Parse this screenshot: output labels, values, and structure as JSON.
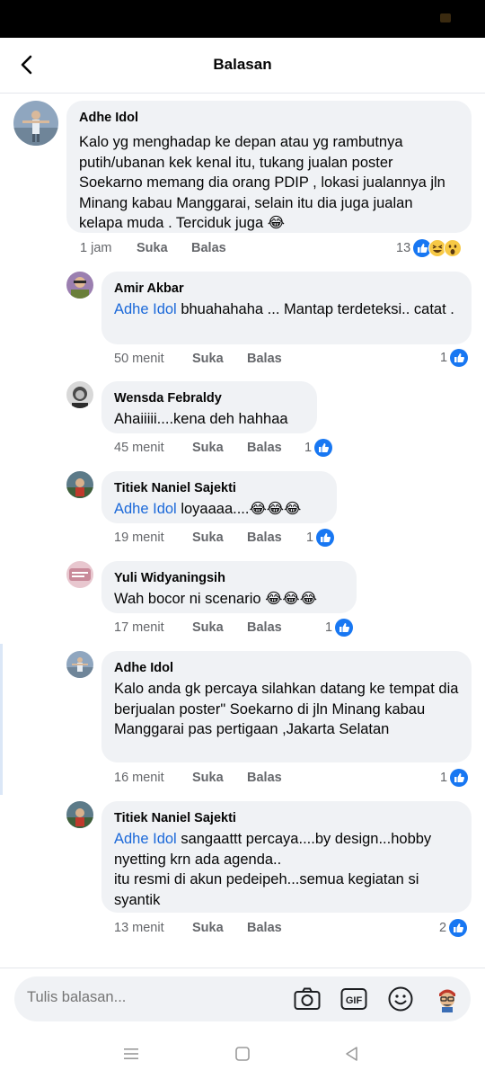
{
  "header": {
    "title": "Balasan"
  },
  "icons": {
    "back": "arrow-left-icon",
    "camera": "camera-icon",
    "gif": "gif-icon",
    "emoji": "smiley-icon",
    "avatar_sticker": "avatar-sticker-icon"
  },
  "colors": {
    "like_blue": "#1877f2",
    "mention_blue": "#1a68d9",
    "bubble_bg": "#f0f2f5",
    "meta_gray": "#65676b"
  },
  "comment": {
    "author": "Adhe Idol",
    "text": "Kalo yg menghadap ke depan atau yg rambutnya putih/ubanan kek kenal itu, tukang jualan poster Soekarno  memang dia orang PDIP , lokasi jualannya jln Minang kabau Manggarai, selain itu dia juga jualan kelapa muda . Terciduk juga 😂",
    "time": "1 jam",
    "like_label": "Suka",
    "reply_label": "Balas",
    "reactions": {
      "count": "13",
      "types": [
        "like",
        "haha",
        "wow"
      ]
    }
  },
  "replies": [
    {
      "author": "Amir Akbar",
      "mention": "Adhe Idol",
      "text": " bhuahahaha ... Mantap terdeteksi.. catat .",
      "time": "50 menit",
      "like_label": "Suka",
      "reply_label": "Balas",
      "reactions": {
        "count": "1"
      }
    },
    {
      "author": "Wensda Febraldy",
      "mention": "",
      "text": "Ahaiiiii....kena deh hahhaa",
      "time": "45 menit",
      "like_label": "Suka",
      "reply_label": "Balas",
      "reactions": {
        "count": "1"
      }
    },
    {
      "author": "Titiek Naniel Sajekti",
      "mention": "Adhe Idol",
      "text": " loyaaaa....😂😂😂",
      "time": "19 menit",
      "like_label": "Suka",
      "reply_label": "Balas",
      "reactions": {
        "count": "1"
      }
    },
    {
      "author": "Yuli Widyaningsih",
      "mention": "",
      "text": "Wah bocor ni scenario 😂😂😂",
      "time": "17 menit",
      "like_label": "Suka",
      "reply_label": "Balas",
      "reactions": {
        "count": "1"
      }
    },
    {
      "author": "Adhe Idol",
      "mention": "",
      "text": "Kalo  anda gk percaya silahkan datang ke tempat dia berjualan poster\" Soekarno di jln Minang kabau  Manggarai  pas pertigaan ,Jakarta Selatan",
      "time": "16 menit",
      "like_label": "Suka",
      "reply_label": "Balas",
      "reactions": {
        "count": "1"
      }
    },
    {
      "author": "Titiek Naniel Sajekti",
      "mention": "Adhe Idol",
      "text": " sangaattt percaya....by design...hobby nyetting krn ada agenda..\nitu resmi di akun pedeipeh...semua kegiatan si syantik",
      "time": "13 menit",
      "like_label": "Suka",
      "reply_label": "Balas",
      "reactions": {
        "count": "2"
      }
    }
  ],
  "composer": {
    "placeholder": "Tulis balasan..."
  },
  "navbar": {
    "items": [
      "menu-icon",
      "home-square-icon",
      "back-triangle-icon"
    ]
  }
}
